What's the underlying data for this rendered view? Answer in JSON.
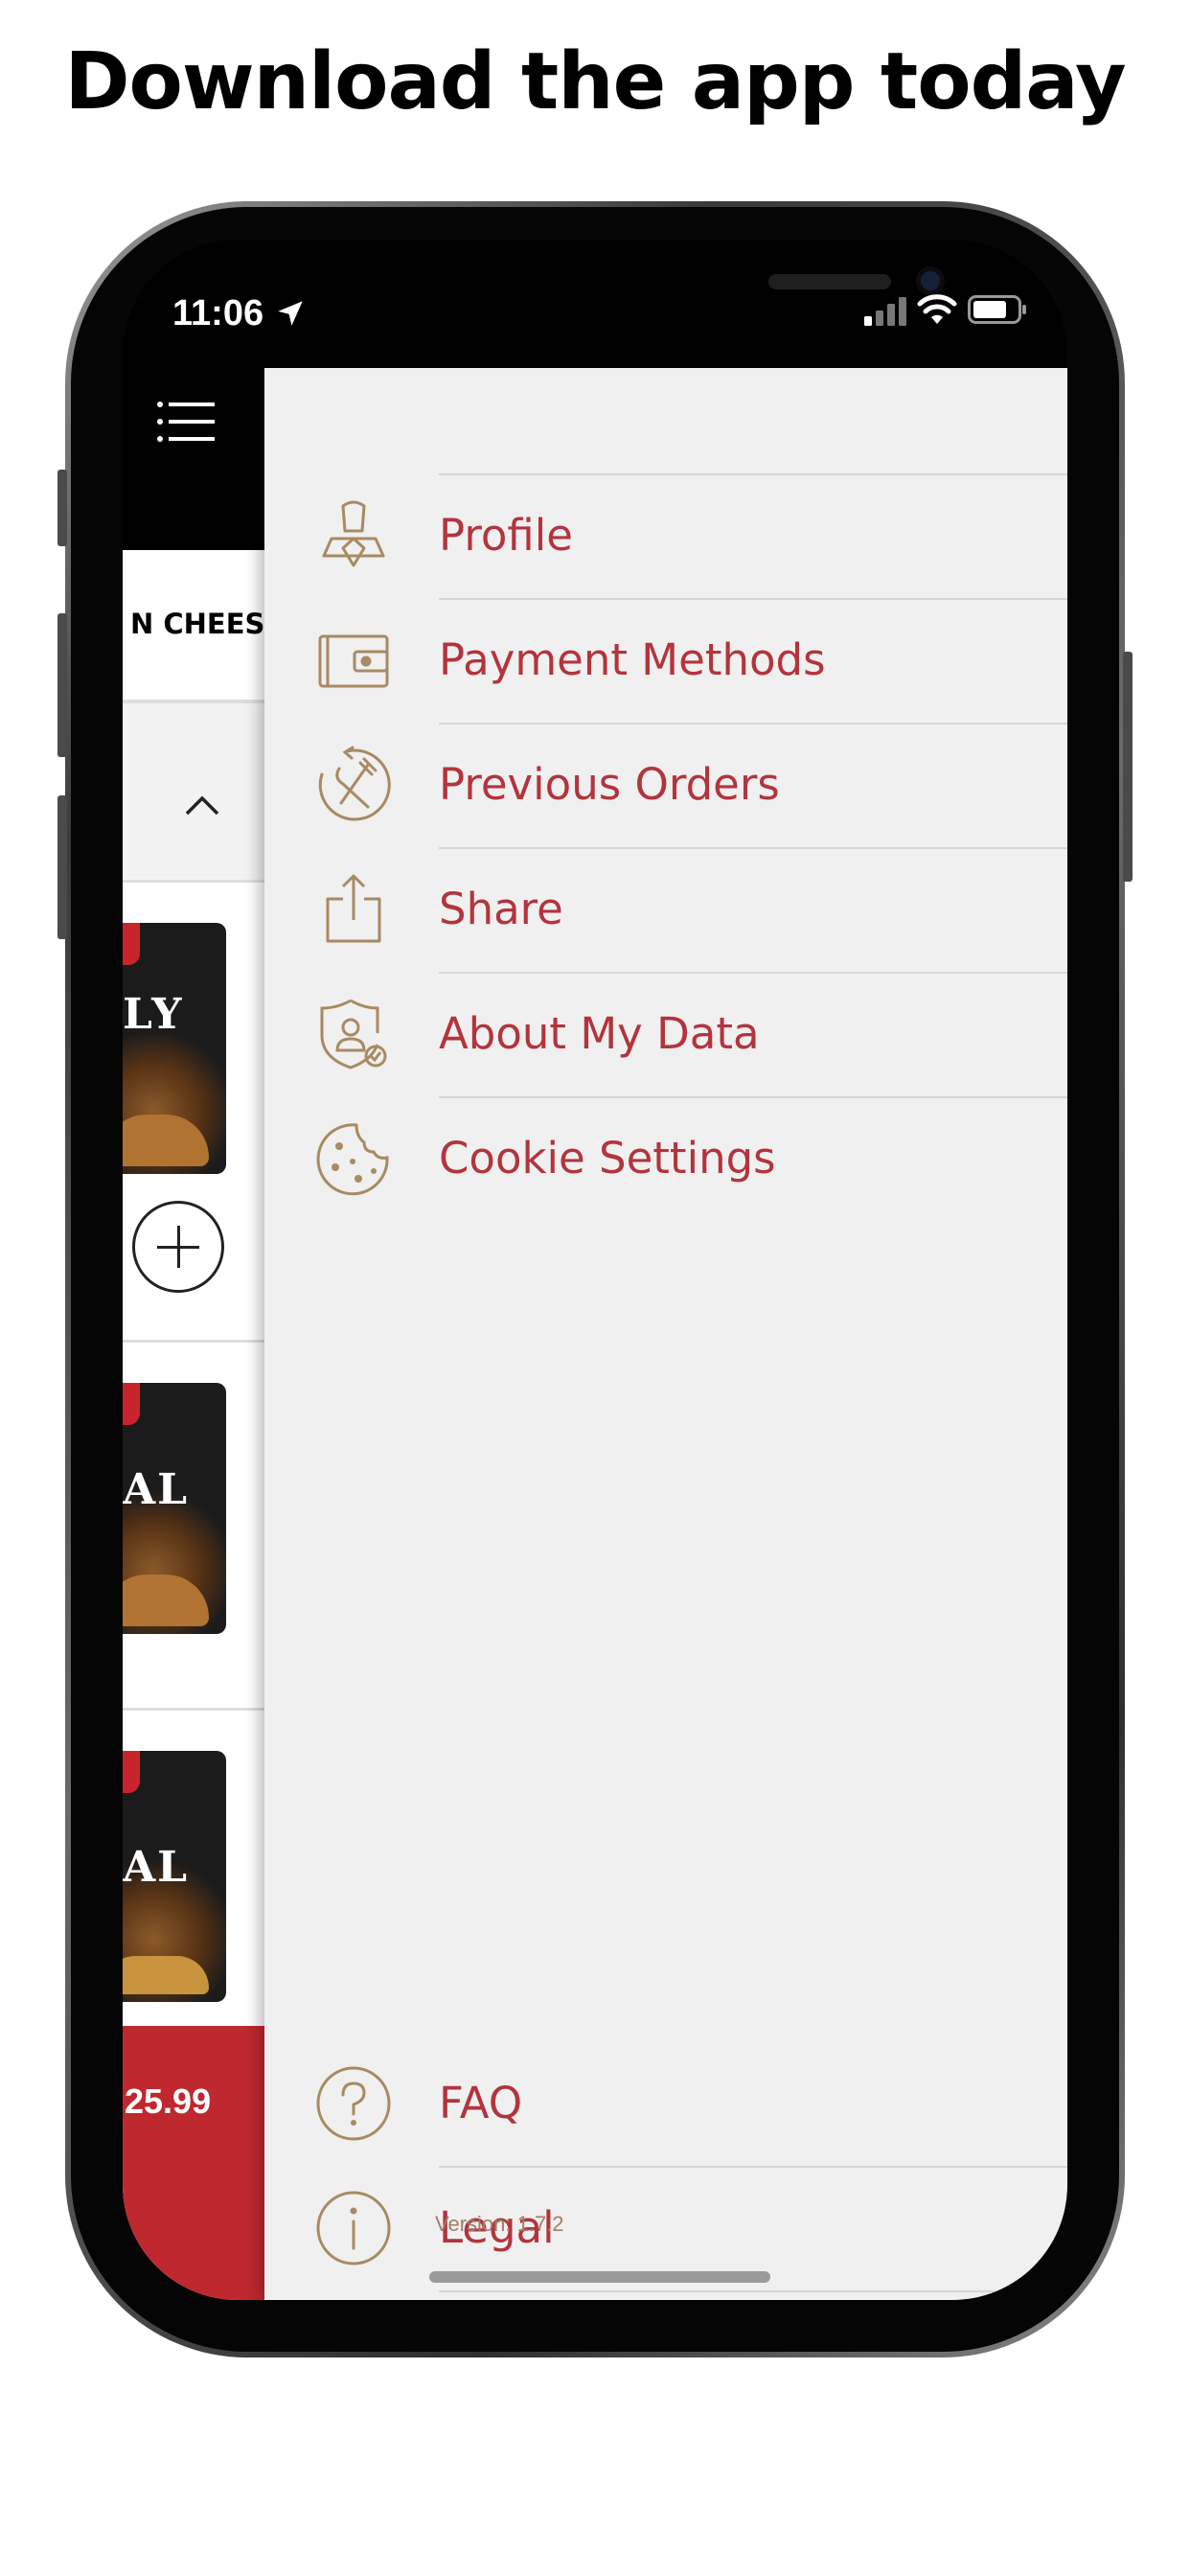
{
  "headline": "Download the app today",
  "status_bar": {
    "time": "11:06",
    "icons": [
      "location-arrow-icon",
      "cellular-signal-icon",
      "wifi-icon",
      "battery-icon"
    ]
  },
  "background_screen": {
    "tab_label": "N CHEESE",
    "promo_texts": [
      "LY\nL",
      "AL",
      "AL"
    ],
    "cart_total": "25.99"
  },
  "menu": {
    "items": [
      {
        "label": "Profile",
        "icon": "profile-icon"
      },
      {
        "label": "Payment Methods",
        "icon": "wallet-icon"
      },
      {
        "label": "Previous Orders",
        "icon": "previous-orders-icon"
      },
      {
        "label": "Share",
        "icon": "share-icon"
      },
      {
        "label": "About My Data",
        "icon": "data-shield-icon"
      },
      {
        "label": "Cookie Settings",
        "icon": "cookie-icon"
      }
    ],
    "footer_items": [
      {
        "label": "FAQ",
        "icon": "question-circle-icon"
      },
      {
        "label": "Legal",
        "icon": "info-circle-icon"
      }
    ],
    "version": "Version: 1.7.2"
  },
  "colors": {
    "accent_text": "#b3343d",
    "icon_gold": "#a88a63",
    "drawer_bg": "#f0f0f0",
    "total_bar": "#c0282f"
  }
}
